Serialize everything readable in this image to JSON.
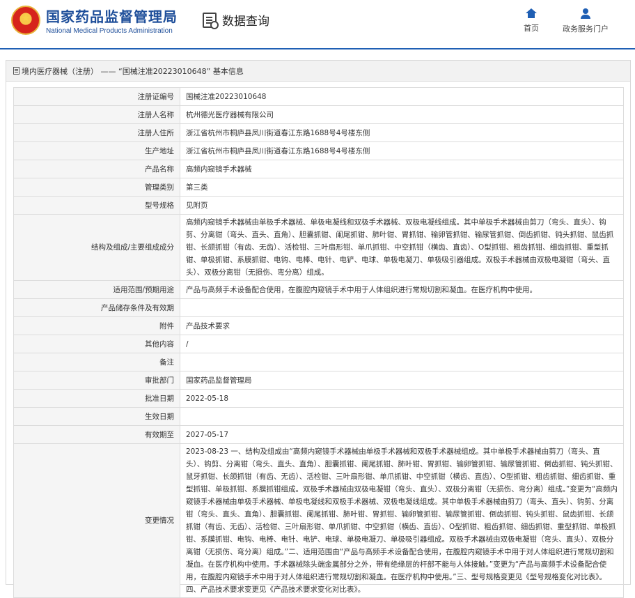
{
  "header": {
    "logo_cn": "国家药品监督管理局",
    "logo_en": "National Medical Products Administration",
    "query_label": "数据查询",
    "nav_home": "首页",
    "nav_portal": "政务服务门户"
  },
  "panel": {
    "title": "境内医疗器械（注册） —— “国械注准20223010648” 基本信息"
  },
  "rows": [
    {
      "label": "注册证编号",
      "value": "国械注准20223010648"
    },
    {
      "label": "注册人名称",
      "value": "杭州德光医疗器械有限公司"
    },
    {
      "label": "注册人住所",
      "value": "浙江省杭州市桐庐县凤川街道春江东路1688号4号楼东侧"
    },
    {
      "label": "生产地址",
      "value": "浙江省杭州市桐庐县凤川街道春江东路1688号4号楼东侧"
    },
    {
      "label": "产品名称",
      "value": "高频内窥镜手术器械"
    },
    {
      "label": "管理类别",
      "value": "第三类"
    },
    {
      "label": "型号规格",
      "value": "见附页"
    },
    {
      "label": "结构及组成/主要组成成分",
      "value": "高频内窥镜手术器械由单极手术器械、单极电凝线和双极手术器械、双极电凝线组成。其中单极手术器械由剪刀（弯头、直头）、钩剪、分离钳（弯头、直头、直角）、胆囊抓钳、阑尾抓钳、肺叶钳、胃抓钳、输卵管抓钳、输尿管抓钳、倒齿抓钳、钝头抓钳、鼠齿抓钳、长颌抓钳（有齿、无齿）、活检钳、三叶扇形钳、单爪抓钳、中空抓钳（横齿、直齿）、O型抓钳、粗齿抓钳、细齿抓钳、重型抓钳、单极抓钳、系膜抓钳、电钩、电棒、电针、电铲、电球、单极电凝刀、单极吸引器组成。双极手术器械由双极电凝钳（弯头、直头）、双极分离钳（无损伤、弯分离）组成。"
    },
    {
      "label": "适用范围/预期用途",
      "value": "产品与高频手术设备配合使用，在腹腔内窥镜手术中用于人体组织进行常规切割和凝血。在医疗机构中使用。"
    },
    {
      "label": "产品储存条件及有效期",
      "value": ""
    },
    {
      "label": "附件",
      "value": "产品技术要求"
    },
    {
      "label": "其他内容",
      "value": "/"
    },
    {
      "label": "备注",
      "value": ""
    },
    {
      "label": "审批部门",
      "value": "国家药品监督管理局"
    },
    {
      "label": "批准日期",
      "value": "2022-05-18"
    },
    {
      "label": "生效日期",
      "value": ""
    },
    {
      "label": "有效期至",
      "value": "2027-05-17"
    },
    {
      "label": "变更情况",
      "value": "2023-08-23 一、结构及组成由“高频内窥镜手术器械由单极手术器械和双极手术器械组成。其中单极手术器械由剪刀（弯头、直头）、钩剪、分离钳（弯头、直头、直角）、胆囊抓钳、阑尾抓钳、肺叶钳、胃抓钳、输卵管抓钳、输尿管抓钳、倒齿抓钳、钝头抓钳、鼠牙抓钳、长颌抓钳（有齿、无齿）、活检钳、三叶扇形钳、单爪抓钳、中空抓钳（横齿、直齿）、O型抓钳、粗齿抓钳、细齿抓钳、重型抓钳、单极抓钳、系膜抓钳组成。双极手术器械由双极电凝钳（弯头、直头）、双极分离钳（无损伤、弯分离）组成。”变更为“高频内窥镜手术器械由单极手术器械、单极电凝线和双极手术器械、双极电凝线组成。其中单极手术器械由剪刀（弯头、直头）、钩剪、分离钳（弯头、直头、直角）、胆囊抓钳、阑尾抓钳、肺叶钳、胃抓钳、输卵管抓钳、输尿管抓钳、倒齿抓钳、钝头抓钳、鼠齿抓钳、长颌抓钳（有齿、无齿）、活检钳、三叶扇形钳、单爪抓钳、中空抓钳（横齿、直齿）、O型抓钳、粗齿抓钳、细齿抓钳、重型抓钳、单极抓钳、系膜抓钳、电钩、电棒、电针、电铲、电球、单极电凝刀、单极吸引器组成。双极手术器械由双极电凝钳（弯头、直头）、双极分离钳（无损伤、弯分离）组成。”二、适用范围由“产品与高频手术设备配合使用，在腹腔内窥镜手术中用于对人体组织进行常规切割和凝血。在医疗机构中使用。手术器械除头端金属部分之外，带有绝缘层的杆部不能与人体接触。”变更为“产品与高频手术设备配合使用，在腹腔内窥镜手术中用于对人体组织进行常规切割和凝血。在医疗机构中使用。”三、型号规格变更见《型号规格变化对比表》。四、产品技术要求变更见《产品技术要求变化对比表》。"
    }
  ]
}
